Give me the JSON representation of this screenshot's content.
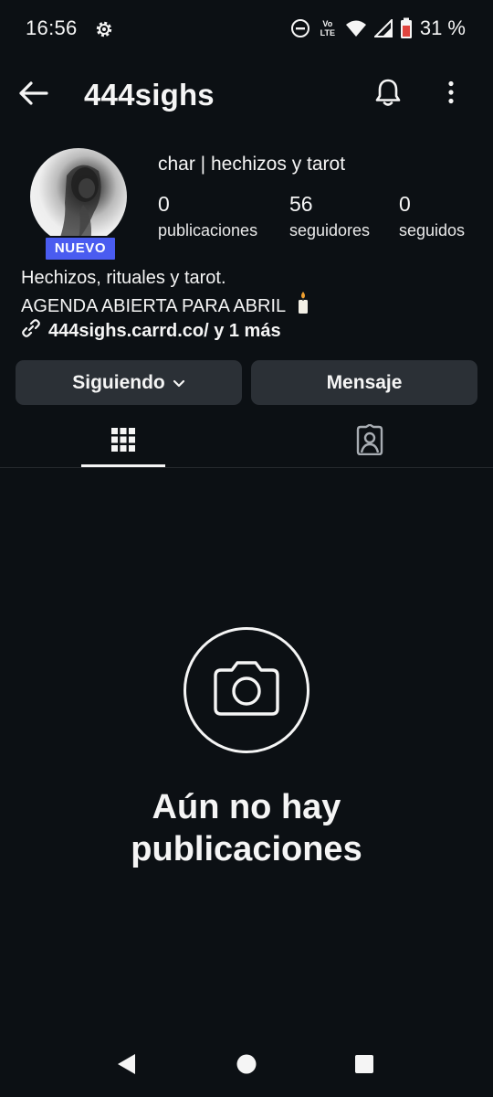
{
  "status_bar": {
    "time": "16:56",
    "volte_top": "Vo",
    "volte_bottom": "LTE",
    "battery_percent": "31 %",
    "battery_level": 0.31,
    "icons": [
      "gear-icon",
      "dnd-icon",
      "volte-icon",
      "wifi-icon",
      "signal-icon",
      "battery-icon"
    ]
  },
  "header": {
    "username": "444sighs",
    "icons": [
      "back-arrow-icon",
      "bell-icon",
      "more-vertical-icon"
    ]
  },
  "profile": {
    "badge": "NUEVO",
    "display_name": "char | hechizos y tarot",
    "stats": [
      {
        "value": "0",
        "label": "publicaciones"
      },
      {
        "value": "56",
        "label": "seguidores"
      },
      {
        "value": "0",
        "label": "seguidos"
      }
    ],
    "bio_line1": "Hechizos, rituales y tarot.",
    "bio_line2": "AGENDA ABIERTA PARA ABRIL",
    "bio_emoji": "candle-icon",
    "link_text": "444sighs.carrd.co/ y 1 más"
  },
  "actions": {
    "following_label": "Siguiendo",
    "message_label": "Mensaje"
  },
  "tabs": {
    "icons": [
      "grid-icon",
      "tagged-person-icon"
    ],
    "active": "grid-icon"
  },
  "empty_state": {
    "line1": "Aún no hay",
    "line2": "publicaciones",
    "icon": "camera-icon"
  },
  "navigation_bar": {
    "icons": [
      "nav-back-icon",
      "nav-home-icon",
      "nav-recents-icon"
    ]
  },
  "colors": {
    "background": "#0c1014",
    "button_bg": "#2b3036",
    "badge_bg": "#4a5cf0",
    "text": "#f5f5f5",
    "battery_red": "#e0443e"
  }
}
